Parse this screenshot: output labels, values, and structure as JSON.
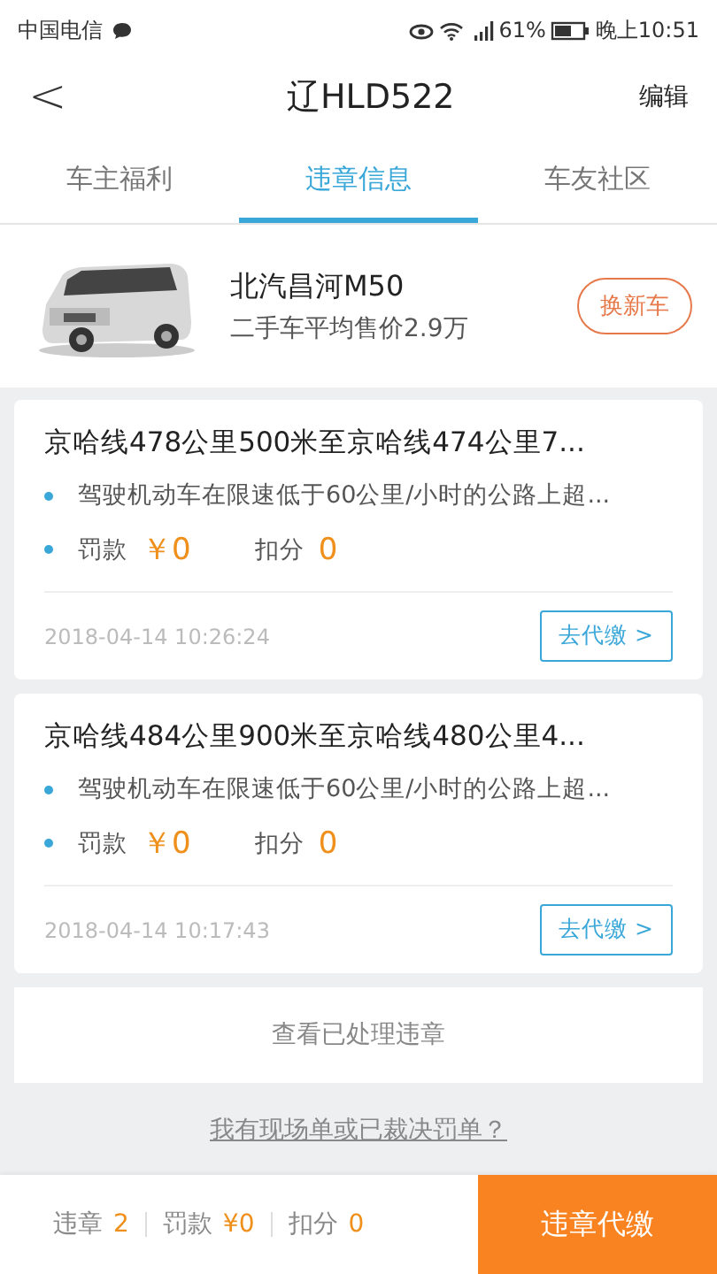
{
  "status_bar": {
    "carrier": "中国电信",
    "battery": "61%",
    "time": "晚上10:51"
  },
  "header": {
    "back": "<",
    "title": "辽HLD522",
    "action": "编辑"
  },
  "tabs": [
    {
      "label": "车主福利",
      "selected": false
    },
    {
      "label": "违章信息",
      "selected": true
    },
    {
      "label": "车友社区",
      "selected": false
    }
  ],
  "car": {
    "model": "北汽昌河M50",
    "price": "二手车平均售价2.9万",
    "button": "换新车"
  },
  "violations": [
    {
      "location": "京哈线478公里500米至京哈线474公里7...",
      "reason": "驾驶机动车在限速低于60公里/小时的公路上超...",
      "fine_label": "罚款",
      "fine": "￥0",
      "points_label": "扣分",
      "points": "0",
      "time": "2018-04-14 10:26:24",
      "button": "去代缴 >"
    },
    {
      "location": "京哈线484公里900米至京哈线480公里4...",
      "reason": "驾驶机动车在限速低于60公里/小时的公路上超...",
      "fine_label": "罚款",
      "fine": "￥0",
      "points_label": "扣分",
      "points": "0",
      "time": "2018-04-14 10:17:43",
      "button": "去代缴 >"
    }
  ],
  "processed_link": "查看已处理违章",
  "ticket_link": "我有现场单或已裁决罚单？",
  "footer": {
    "stats": [
      {
        "label": "违章",
        "value": "2"
      },
      {
        "label": "罚款",
        "value": "¥0"
      },
      {
        "label": "扣分",
        "value": "0"
      }
    ],
    "button": "违章代缴"
  }
}
